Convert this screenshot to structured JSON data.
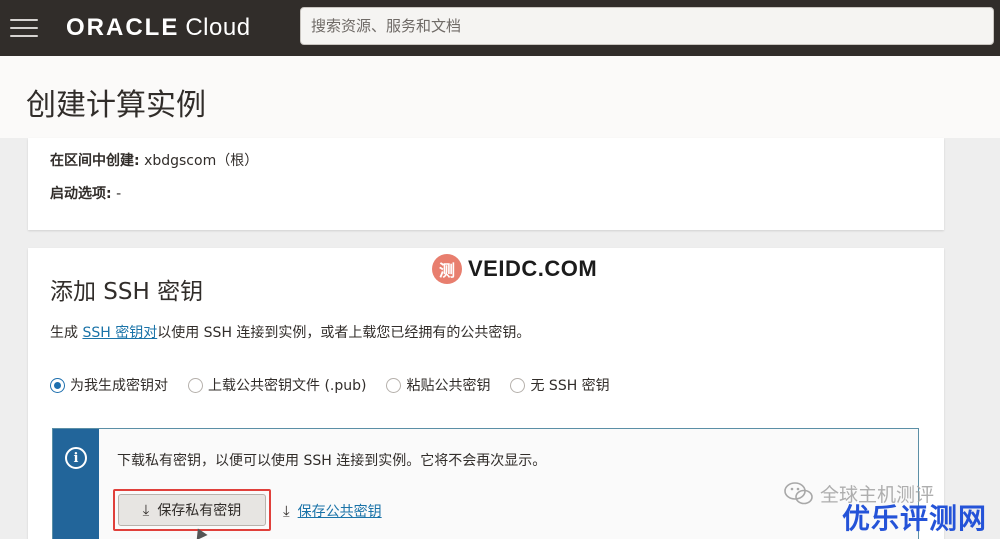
{
  "header": {
    "brand_oracle": "ORACLE",
    "brand_cloud": "Cloud",
    "search_placeholder": "搜索资源、服务和文档"
  },
  "page": {
    "title": "创建计算实例"
  },
  "summary": {
    "compartment_label": "在区间中创建:",
    "compartment_value": "xbdgscom（根）",
    "boot_label": "启动选项:",
    "boot_value": "-"
  },
  "ssh": {
    "title": "添加 SSH 密钥",
    "desc_prefix": "生成 ",
    "desc_link": "SSH 密钥对",
    "desc_suffix": "以使用 SSH 连接到实例，或者上载您已经拥有的公共密钥。",
    "options": [
      {
        "label": "为我生成密钥对",
        "selected": true
      },
      {
        "label": "上载公共密钥文件 (.pub)",
        "selected": false
      },
      {
        "label": "粘贴公共密钥",
        "selected": false
      },
      {
        "label": "无 SSH 密钥",
        "selected": false
      }
    ],
    "info_message": "下载私有密钥，以便可以使用 SSH 连接到实例。它将不会再次显示。",
    "save_private_label": "保存私有密钥",
    "save_public_label": "保存公共密钥"
  },
  "watermarks": {
    "badge": "测",
    "site": "VEIDC.COM",
    "wechat_text": "全球主机测评",
    "brand": "优乐评测网"
  },
  "colors": {
    "topbar": "#312d2a",
    "accent_blue": "#22659a",
    "link": "#1a73a8",
    "highlight_red": "#e0403b"
  }
}
